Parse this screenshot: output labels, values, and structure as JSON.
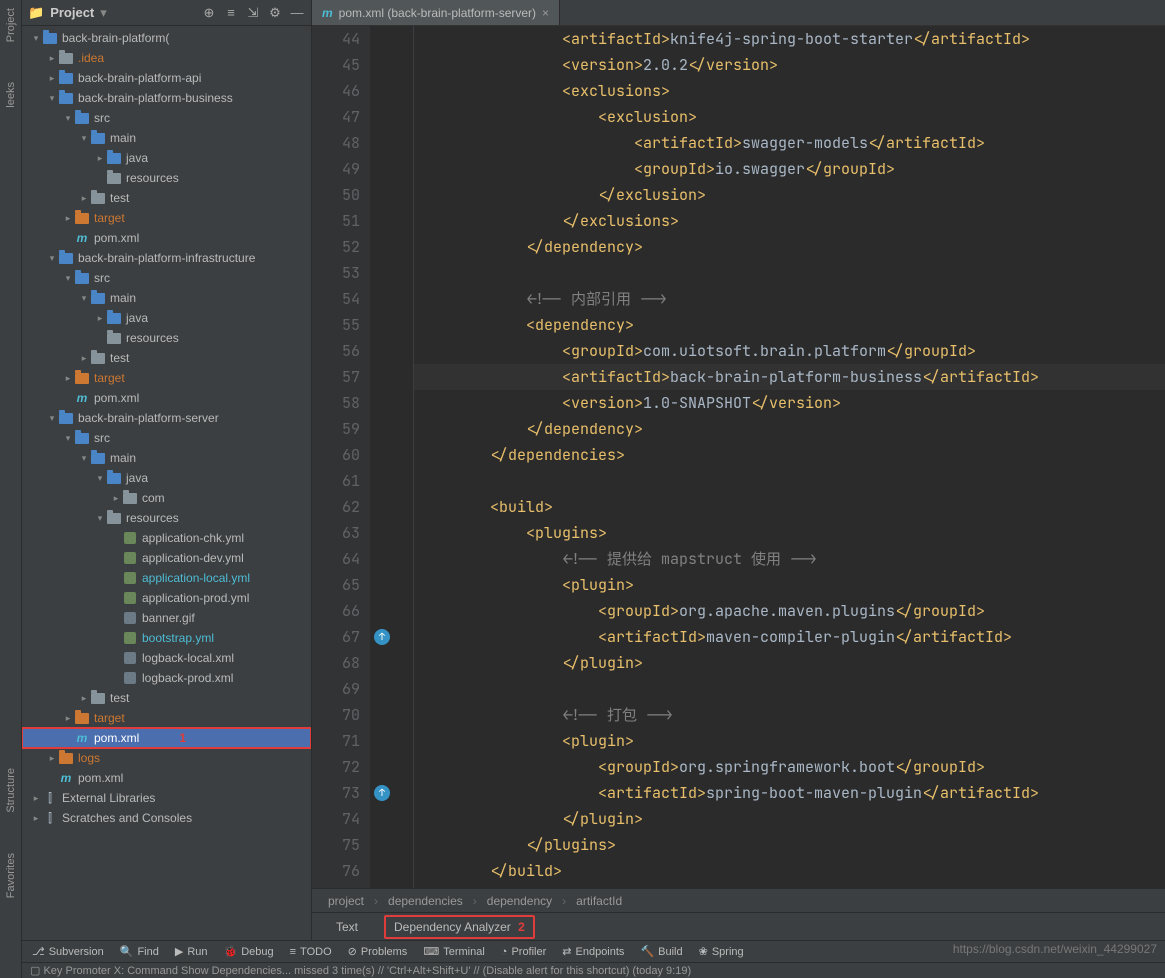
{
  "leftRail": [
    "Project",
    "leeks",
    "Structure",
    "Favorites"
  ],
  "projectPanel": {
    "title": "Project",
    "headerIcons": [
      "target-icon",
      "sort-icon",
      "expand-icon",
      "gear-icon",
      "minimize-icon"
    ]
  },
  "tree": [
    {
      "d": 0,
      "a": "v",
      "i": "folder-blue",
      "l": "back-brain-platform(",
      "cls": ""
    },
    {
      "d": 1,
      "a": ">",
      "i": "folder",
      "l": ".idea",
      "cls": "orange"
    },
    {
      "d": 1,
      "a": ">",
      "i": "folder-blue",
      "l": "back-brain-platform-api",
      "cls": ""
    },
    {
      "d": 1,
      "a": "v",
      "i": "folder-blue",
      "l": "back-brain-platform-business",
      "cls": ""
    },
    {
      "d": 2,
      "a": "v",
      "i": "folder-blue",
      "l": "src",
      "cls": ""
    },
    {
      "d": 3,
      "a": "v",
      "i": "folder-blue",
      "l": "main",
      "cls": ""
    },
    {
      "d": 4,
      "a": ">",
      "i": "folder-blue",
      "l": "java",
      "cls": ""
    },
    {
      "d": 4,
      "a": "",
      "i": "folder",
      "l": "resources",
      "cls": ""
    },
    {
      "d": 3,
      "a": ">",
      "i": "folder",
      "l": "test",
      "cls": ""
    },
    {
      "d": 2,
      "a": ">",
      "i": "folder-orange",
      "l": "target",
      "cls": "orange"
    },
    {
      "d": 2,
      "a": "",
      "i": "m",
      "l": "pom.xml",
      "cls": ""
    },
    {
      "d": 1,
      "a": "v",
      "i": "folder-blue",
      "l": "back-brain-platform-infrastructure",
      "cls": ""
    },
    {
      "d": 2,
      "a": "v",
      "i": "folder-blue",
      "l": "src",
      "cls": ""
    },
    {
      "d": 3,
      "a": "v",
      "i": "folder-blue",
      "l": "main",
      "cls": ""
    },
    {
      "d": 4,
      "a": ">",
      "i": "folder-blue",
      "l": "java",
      "cls": ""
    },
    {
      "d": 4,
      "a": "",
      "i": "folder",
      "l": "resources",
      "cls": ""
    },
    {
      "d": 3,
      "a": ">",
      "i": "folder",
      "l": "test",
      "cls": ""
    },
    {
      "d": 2,
      "a": ">",
      "i": "folder-orange",
      "l": "target",
      "cls": "orange"
    },
    {
      "d": 2,
      "a": "",
      "i": "m",
      "l": "pom.xml",
      "cls": ""
    },
    {
      "d": 1,
      "a": "v",
      "i": "folder-blue",
      "l": "back-brain-platform-server",
      "cls": ""
    },
    {
      "d": 2,
      "a": "v",
      "i": "folder-blue",
      "l": "src",
      "cls": ""
    },
    {
      "d": 3,
      "a": "v",
      "i": "folder-blue",
      "l": "main",
      "cls": ""
    },
    {
      "d": 4,
      "a": "v",
      "i": "folder-blue",
      "l": "java",
      "cls": ""
    },
    {
      "d": 5,
      "a": ">",
      "i": "folder",
      "l": "com",
      "cls": ""
    },
    {
      "d": 4,
      "a": "v",
      "i": "folder",
      "l": "resources",
      "cls": ""
    },
    {
      "d": 5,
      "a": "",
      "i": "yml",
      "l": "application-chk.yml",
      "cls": ""
    },
    {
      "d": 5,
      "a": "",
      "i": "yml",
      "l": "application-dev.yml",
      "cls": ""
    },
    {
      "d": 5,
      "a": "",
      "i": "yml",
      "l": "application-local.yml",
      "cls": "cyan"
    },
    {
      "d": 5,
      "a": "",
      "i": "yml",
      "l": "application-prod.yml",
      "cls": ""
    },
    {
      "d": 5,
      "a": "",
      "i": "file",
      "l": "banner.gif",
      "cls": ""
    },
    {
      "d": 5,
      "a": "",
      "i": "yml",
      "l": "bootstrap.yml",
      "cls": "cyan"
    },
    {
      "d": 5,
      "a": "",
      "i": "file",
      "l": "logback-local.xml",
      "cls": ""
    },
    {
      "d": 5,
      "a": "",
      "i": "file",
      "l": "logback-prod.xml",
      "cls": ""
    },
    {
      "d": 3,
      "a": ">",
      "i": "folder",
      "l": "test",
      "cls": ""
    },
    {
      "d": 2,
      "a": ">",
      "i": "folder-orange",
      "l": "target",
      "cls": "orange"
    },
    {
      "d": 2,
      "a": "",
      "i": "m",
      "l": "pom.xml",
      "cls": "",
      "sel": true,
      "ann": "1"
    },
    {
      "d": 1,
      "a": ">",
      "i": "folder-orange",
      "l": "logs",
      "cls": "orange"
    },
    {
      "d": 1,
      "a": "",
      "i": "m",
      "l": "pom.xml",
      "cls": ""
    },
    {
      "d": 0,
      "a": ">",
      "i": "lib",
      "l": "External Libraries",
      "cls": ""
    },
    {
      "d": 0,
      "a": ">",
      "i": "lib",
      "l": "Scratches and Consoles",
      "cls": ""
    }
  ],
  "editorTab": {
    "label": "pom.xml (back-brain-platform-server)",
    "icon": "m"
  },
  "code": {
    "start": 44,
    "lines": [
      "                <artifactId>knife4j-spring-boot-starter</artifactId>",
      "                <version>2.0.2</version>",
      "                <exclusions>",
      "                    <exclusion>",
      "                        <artifactId>swagger-models</artifactId>",
      "                        <groupId>io.swagger</groupId>",
      "                    </exclusion>",
      "                </exclusions>",
      "            </dependency>",
      "",
      "            <!-- 内部引用 -->",
      "            <dependency>",
      "                <groupId>com.uiotsoft.brain.platform</groupId>",
      "                <artifactId>back-brain-platform-business</artifactId>",
      "                <version>1.0-SNAPSHOT</version>",
      "            </dependency>",
      "        </dependencies>",
      "",
      "        <build>",
      "            <plugins>",
      "                <!-- 提供给 mapstruct 使用 -->",
      "                <plugin>",
      "                    <groupId>org.apache.maven.plugins</groupId>",
      "                    <artifactId>maven-compiler-plugin</artifactId>",
      "                </plugin>",
      "",
      "                <!-- 打包 -->",
      "                <plugin>",
      "                    <groupId>org.springframework.boot</groupId>",
      "                    <artifactId>spring-boot-maven-plugin</artifactId>",
      "                </plugin>",
      "            </plugins>",
      "        </build>"
    ],
    "highlightLine": 57,
    "markers": {
      "67": "↑",
      "73": "↑"
    }
  },
  "breadcrumb": [
    "project",
    "dependencies",
    "dependency",
    "artifactId"
  ],
  "subTabs": {
    "left": "Text",
    "right": "Dependency Analyzer",
    "ann": "2"
  },
  "toolStrip": [
    "Subversion",
    "Find",
    "Run",
    "Debug",
    "TODO",
    "Problems",
    "Terminal",
    "Profiler",
    "Endpoints",
    "Build",
    "Spring"
  ],
  "statusBar": "Key Promoter X: Command Show Dependencies... missed 3 time(s) // 'Ctrl+Alt+Shift+U' // (Disable alert for this shortcut) (today 9:19)",
  "watermark": "https://blog.csdn.net/weixin_44299027"
}
